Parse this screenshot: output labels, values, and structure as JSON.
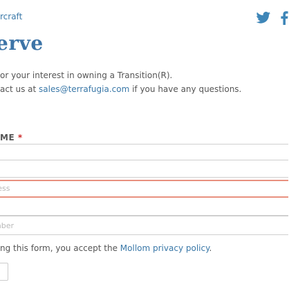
{
  "header": {
    "breadcrumb": "rcraft",
    "social": {
      "twitter_icon": "twitter-icon",
      "facebook_icon": "facebook-icon"
    }
  },
  "page": {
    "title": "erve",
    "intro_line1": "or your interest in owning a Transition(R).",
    "intro_line2_prefix": "act us at ",
    "intro_email": "sales@terrafugia.com",
    "intro_line2_suffix": " if you have any questions."
  },
  "form": {
    "name_label": "ME",
    "required_mark": "*",
    "fields": [
      {
        "value": "",
        "placeholder": ""
      },
      {
        "value": "",
        "placeholder": ""
      },
      {
        "value": "",
        "placeholder": "ress"
      },
      {
        "value": "",
        "placeholder": ""
      },
      {
        "value": "",
        "placeholder": "mber"
      }
    ],
    "legal_prefix": "ng this form, you accept the ",
    "legal_link": "Mollom privacy policy",
    "legal_suffix": "."
  },
  "colors": {
    "accent": "#3d74a7",
    "link": "#3a78a8",
    "error_border": "#e8907f",
    "required": "#cc2a2a"
  }
}
